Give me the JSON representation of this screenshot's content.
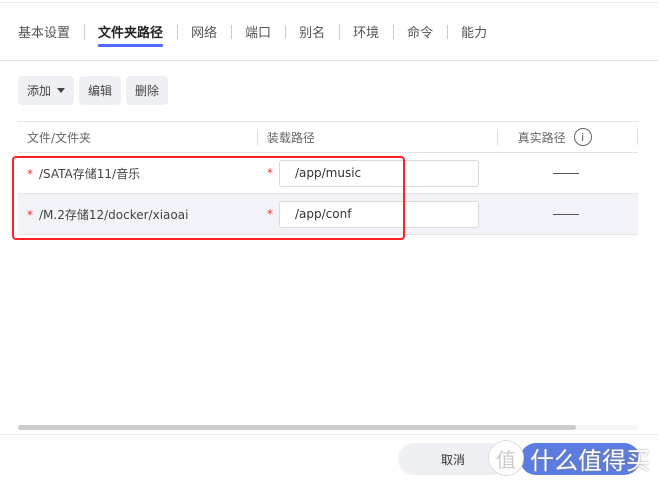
{
  "tabs": [
    "基本设置",
    "文件夹路径",
    "网络",
    "端口",
    "别名",
    "环境",
    "命令",
    "能力"
  ],
  "toolbar": {
    "add": "添加",
    "edit": "编辑",
    "delete": "删除"
  },
  "table": {
    "headers": [
      "文件/文件夹",
      "装载路径",
      "真实路径"
    ],
    "rows": [
      {
        "source": "/SATA存储11/音乐",
        "mount": "/app/music",
        "real": "——"
      },
      {
        "source": "/M.2存储12/docker/xiaoai",
        "mount": "/app/conf",
        "real": "——"
      }
    ]
  },
  "footer": {
    "cancel": "取消"
  },
  "watermark": {
    "icon": "值",
    "text": "什么值得买"
  }
}
